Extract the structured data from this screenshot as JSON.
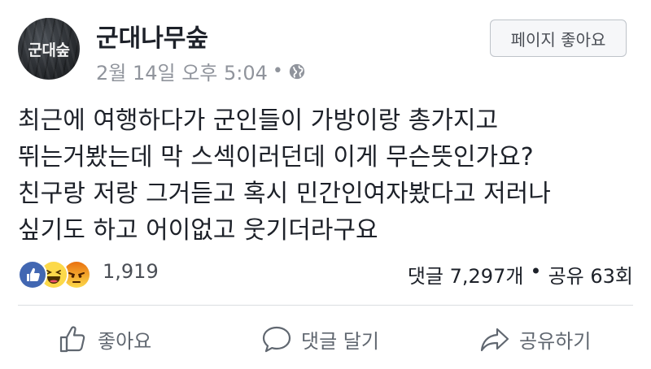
{
  "header": {
    "avatar_text": "군대숲",
    "page_name": "군대나무숲",
    "timestamp": "2월 14일 오후 5:04",
    "separator": "•",
    "privacy_icon": "globe-icon",
    "like_page_label": "페이지 좋아요"
  },
  "post": {
    "lines": [
      "최근에 여행하다가 군인들이 가방이랑 총가지고",
      "뛰는거봤는데 막 스섹이러던데 이게 무슨뜻인가요?",
      "친구랑 저랑 그거듣고 혹시 민간인여자봤다고 저러나",
      "싶기도 하고 어이없고 웃기더라구요"
    ]
  },
  "stats": {
    "reaction_icons": [
      "like-reaction-icon",
      "haha-reaction-icon",
      "angry-reaction-icon"
    ],
    "reaction_count": "1,919",
    "comments": "댓글 7,297개",
    "separator": "•",
    "shares": "공유 63회"
  },
  "actions": {
    "like_label": "좋아요",
    "comment_label": "댓글 달기",
    "share_label": "공유하기"
  },
  "colors": {
    "like_blue": "#4267b2",
    "reaction_yellow": "#fcd94a",
    "angry_orange": "#e9710f",
    "meta_gray": "#90949c"
  }
}
